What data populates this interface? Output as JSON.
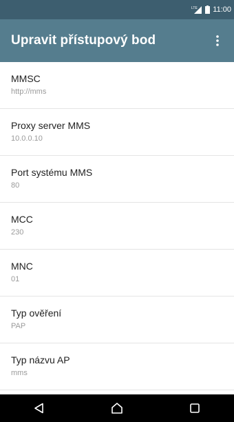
{
  "status_bar": {
    "time": "11:00",
    "network_label": "LTE",
    "icons": [
      "signal-icon",
      "battery-icon"
    ]
  },
  "app_bar": {
    "title": "Upravit přístupový bod",
    "menu_icon": "overflow-menu-icon"
  },
  "items": [
    {
      "label": "MMSC",
      "value": "http://mms"
    },
    {
      "label": "Proxy server MMS",
      "value": "10.0.0.10"
    },
    {
      "label": "Port systému MMS",
      "value": "80"
    },
    {
      "label": "MCC",
      "value": "230"
    },
    {
      "label": "MNC",
      "value": "01"
    },
    {
      "label": "Typ ověření",
      "value": "PAP"
    },
    {
      "label": "Typ názvu AP",
      "value": "mms"
    }
  ],
  "nav_bar": {
    "buttons": [
      "back-icon",
      "home-icon",
      "recents-icon"
    ]
  },
  "colors": {
    "status_bar": "#3d5e6f",
    "app_bar": "#557d8e",
    "nav_bar": "#000000"
  }
}
